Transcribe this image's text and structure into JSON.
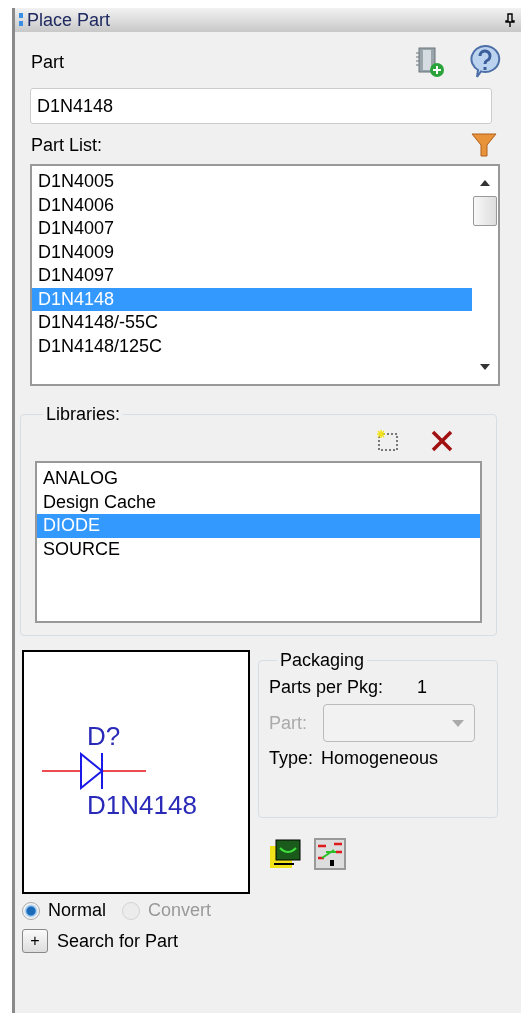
{
  "panel": {
    "title": "Place Part"
  },
  "part": {
    "label": "Part",
    "value": "D1N4148"
  },
  "part_list": {
    "label": "Part List:",
    "items": [
      {
        "name": "D1N4005",
        "selected": false
      },
      {
        "name": "D1N4006",
        "selected": false
      },
      {
        "name": "D1N4007",
        "selected": false
      },
      {
        "name": "D1N4009",
        "selected": false
      },
      {
        "name": "D1N4097",
        "selected": false
      },
      {
        "name": "D1N4148",
        "selected": true
      },
      {
        "name": "D1N4148/-55C",
        "selected": false
      },
      {
        "name": "D1N4148/125C",
        "selected": false
      }
    ]
  },
  "libraries": {
    "label": "Libraries:",
    "items": [
      {
        "name": "ANALOG",
        "selected": false
      },
      {
        "name": "Design Cache",
        "selected": false
      },
      {
        "name": "DIODE",
        "selected": true
      },
      {
        "name": "SOURCE",
        "selected": false
      }
    ]
  },
  "preview": {
    "ref": "D?",
    "value": "D1N4148"
  },
  "packaging": {
    "title": "Packaging",
    "parts_per_pkg_label": "Parts per Pkg:",
    "parts_per_pkg": "1",
    "part_label": "Part:",
    "part_disabled": true,
    "type_label": "Type:",
    "type": "Homogeneous"
  },
  "view": [
    {
      "label": "Normal",
      "selected": true,
      "disabled": false
    },
    {
      "label": "Convert",
      "selected": false,
      "disabled": true
    }
  ],
  "search": {
    "button": "+",
    "label": "Search for Part"
  }
}
